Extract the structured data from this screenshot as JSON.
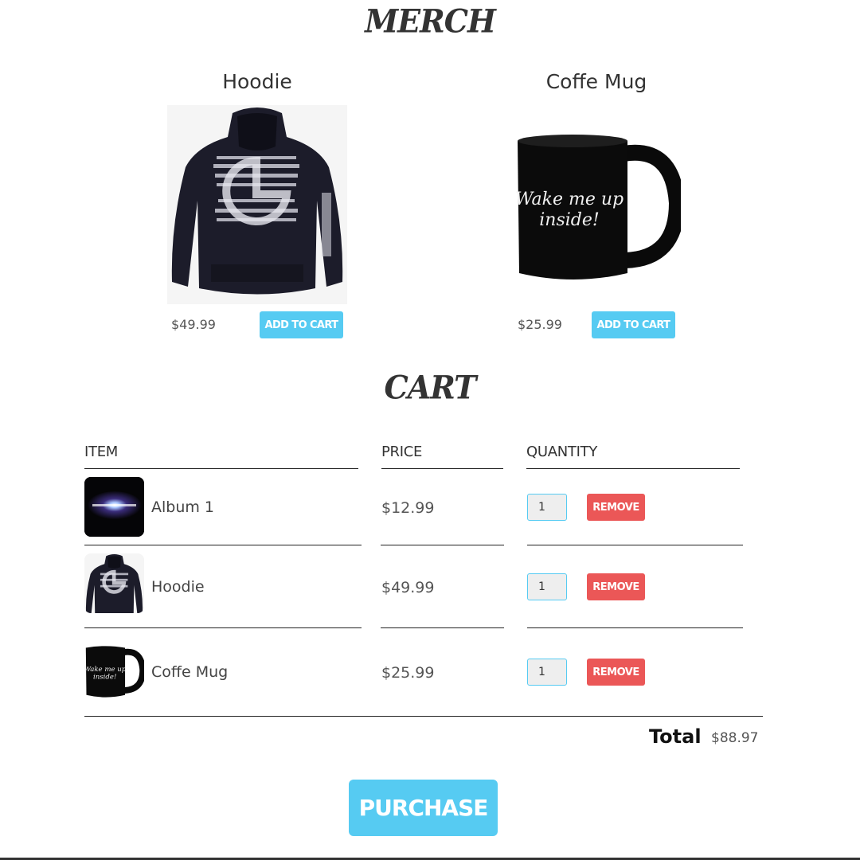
{
  "merch": {
    "title": "MERCH",
    "products": [
      {
        "name": "Hoodie",
        "price": "$49.99",
        "button": "ADD TO CART",
        "image": "hoodie-image"
      },
      {
        "name": "Coffe Mug",
        "price": "$25.99",
        "button": "ADD TO CART",
        "image": "mug-image",
        "mug_text": [
          "Wake me up",
          "inside!"
        ]
      }
    ]
  },
  "cart": {
    "title": "CART",
    "headers": {
      "item": "ITEM",
      "price": "PRICE",
      "quantity": "QUANTITY"
    },
    "rows": [
      {
        "name": "Album 1",
        "price": "$12.99",
        "quantity": "1",
        "remove": "REMOVE",
        "image": "album-image"
      },
      {
        "name": "Hoodie",
        "price": "$49.99",
        "quantity": "1",
        "remove": "REMOVE",
        "image": "hoodie-image"
      },
      {
        "name": "Coffe Mug",
        "price": "$25.99",
        "quantity": "1",
        "remove": "REMOVE",
        "image": "mug-image",
        "mug_text": [
          "Wake me up",
          "inside!"
        ]
      }
    ],
    "total_label": "Total",
    "total_value": "$88.97",
    "purchase_button": "PURCHASE"
  },
  "colors": {
    "accent": "#56cbf2",
    "danger": "#eb5757",
    "text": "#333333"
  }
}
